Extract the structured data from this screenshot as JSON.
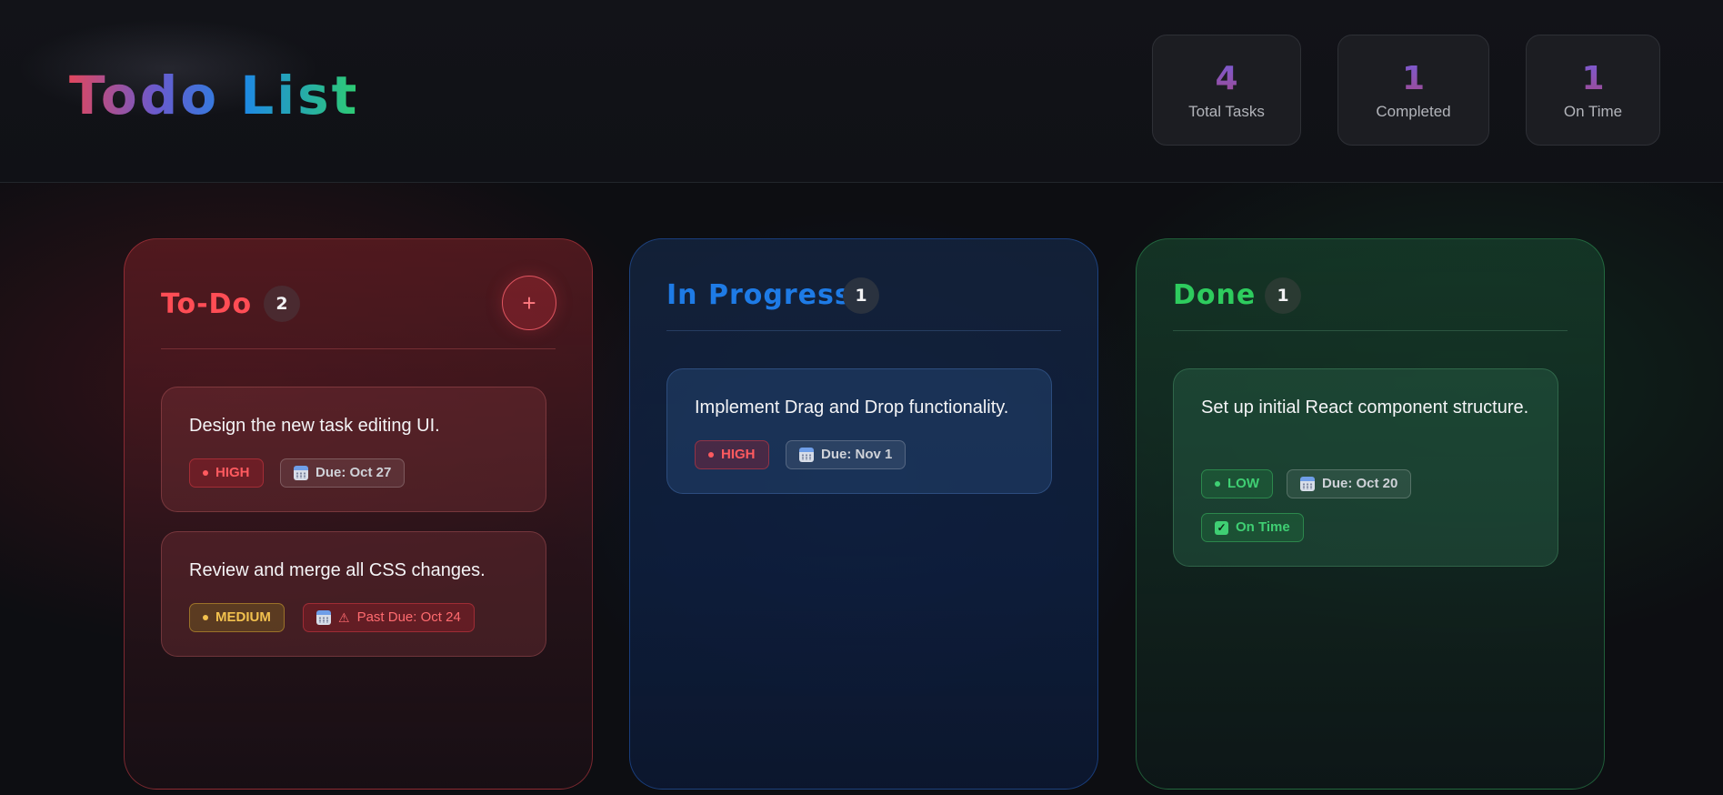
{
  "app": {
    "title": "Todo List"
  },
  "stats": [
    {
      "value": "4",
      "label": "Total Tasks"
    },
    {
      "value": "1",
      "label": "Completed"
    },
    {
      "value": "1",
      "label": "On Time"
    }
  ],
  "columns": {
    "todo": {
      "title": "To-Do",
      "count": "2",
      "add_label": "+",
      "accent": "#ff4d55",
      "cards": [
        {
          "text": "Design the new task editing UI.",
          "priority": "HIGH",
          "due": "Due: Oct 27"
        },
        {
          "text": "Review and merge all CSS changes.",
          "priority": "MEDIUM",
          "due_icon": "⚠",
          "due": "Past Due: Oct 24"
        }
      ]
    },
    "in_progress": {
      "title": "In Progress",
      "count": "1",
      "accent": "#1e7be6",
      "cards": [
        {
          "text": "Implement Drag and Drop functionality.",
          "priority": "HIGH",
          "due": "Due: Nov 1"
        }
      ]
    },
    "done": {
      "title": "Done",
      "count": "1",
      "accent": "#2ecc5e",
      "cards": [
        {
          "text": "Set up initial React component structure.",
          "priority": "LOW",
          "due": "Due: Oct 20",
          "status": "On Time"
        }
      ]
    }
  },
  "icons": {
    "calendar": "calendar-icon",
    "check": "check-icon",
    "warning": "warning-icon",
    "add": "plus-icon"
  }
}
